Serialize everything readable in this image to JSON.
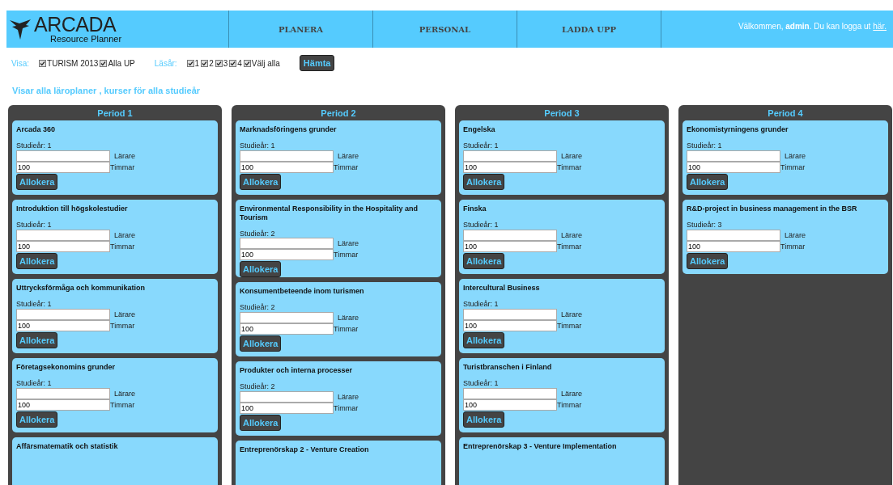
{
  "header": {
    "logo": {
      "title": "ARCADA",
      "subtitle": "Resource Planner"
    },
    "nav": [
      {
        "label": "PLANERA",
        "selected": false
      },
      {
        "label": "PERSONAL",
        "selected": false
      },
      {
        "label": "LADDA UPP",
        "selected": false
      }
    ],
    "welcome": {
      "text": "Välkommen, **admin**. Du kan logga ut",
      "link": "här."
    }
  },
  "filters": {
    "groups": [
      {
        "label": "Visa:",
        "options": [
          {
            "label": "TURISM 2013",
            "checked": true
          },
          {
            "label": "Alla UP",
            "checked": true
          }
        ]
      },
      {
        "label": "Läsår:",
        "options": [
          {
            "label": "1",
            "checked": true
          },
          {
            "label": "2",
            "checked": true
          },
          {
            "label": "3",
            "checked": true
          },
          {
            "label": "4",
            "checked": true
          },
          {
            "label": "Välj alla",
            "checked": true
          }
        ]
      }
    ],
    "button": "Hämta"
  },
  "heading": "Visar alla läroplaner , kurser för alla studieår",
  "periods": [
    {
      "title": "Period 1",
      "courses": [
        {
          "title": "Arcada 360",
          "year": "Studieår: 1",
          "teacher_label": "Lärare",
          "hours": "100",
          "hours_label": "Timmar",
          "button": "Allokera"
        },
        {
          "title": "Introduktion till högskolestudier",
          "year": "Studieår: 1",
          "teacher_label": "Lärare",
          "hours": "100",
          "hours_label": "Timmar",
          "button": "Allokera"
        },
        {
          "title": "Uttrycksförmåga och kommunikation",
          "year": "Studieår: 1",
          "teacher_label": "Lärare",
          "hours": "100",
          "hours_label": "Timmar",
          "button": "Allokera"
        },
        {
          "title": "Företagsekonomins grunder",
          "year": "Studieår: 1",
          "teacher_label": "Lärare",
          "hours": "100",
          "hours_label": "Timmar",
          "button": "Allokera"
        },
        {
          "title": "Affärsmatematik och statistik"
        }
      ]
    },
    {
      "title": "Period 2",
      "courses": [
        {
          "title": "Marknadsföringens grunder",
          "year": "Studieår: 1",
          "teacher_label": "Lärare",
          "hours": "100",
          "hours_label": "Timmar",
          "button": "Allokera"
        },
        {
          "title": "Environmental Responsibility in the Hospitality and Tourism",
          "year": "Studieår: 2",
          "teacher_label": "Lärare",
          "hours": "100",
          "hours_label": "Timmar",
          "button": "Allokera"
        },
        {
          "title": "Konsumentbeteende inom turismen",
          "year": "Studieår: 2",
          "teacher_label": "Lärare",
          "hours": "100",
          "hours_label": "Timmar",
          "button": "Allokera"
        },
        {
          "title": "Produkter och interna processer",
          "year": "Studieår: 2",
          "teacher_label": "Lärare",
          "hours": "100",
          "hours_label": "Timmar",
          "button": "Allokera"
        },
        {
          "title": "Entreprenörskap 2 - Venture Creation"
        }
      ]
    },
    {
      "title": "Period 3",
      "courses": [
        {
          "title": "Engelska",
          "year": "Studieår: 1",
          "teacher_label": "Lärare",
          "hours": "100",
          "hours_label": "Timmar",
          "button": "Allokera"
        },
        {
          "title": "Finska",
          "year": "Studieår: 1",
          "teacher_label": "Lärare",
          "hours": "100",
          "hours_label": "Timmar",
          "button": "Allokera"
        },
        {
          "title": "Intercultural Business",
          "year": "Studieår: 1",
          "teacher_label": "Lärare",
          "hours": "100",
          "hours_label": "Timmar",
          "button": "Allokera"
        },
        {
          "title": "Turistbranschen i Finland",
          "year": "Studieår: 1",
          "teacher_label": "Lärare",
          "hours": "100",
          "hours_label": "Timmar",
          "button": "Allokera"
        },
        {
          "title": "Entreprenörskap 3 - Venture Implementation"
        }
      ]
    },
    {
      "title": "Period 4",
      "courses": [
        {
          "title": "Ekonomistyrningens grunder",
          "year": "Studieår: 1",
          "teacher_label": "Lärare",
          "hours": "100",
          "hours_label": "Timmar",
          "button": "Allokera"
        },
        {
          "title": "R&D-project in business management in the BSR",
          "year": "Studieår: 3",
          "teacher_label": "Lärare",
          "hours": "100",
          "hours_label": "Timmar",
          "button": "Allokera"
        }
      ]
    }
  ]
}
